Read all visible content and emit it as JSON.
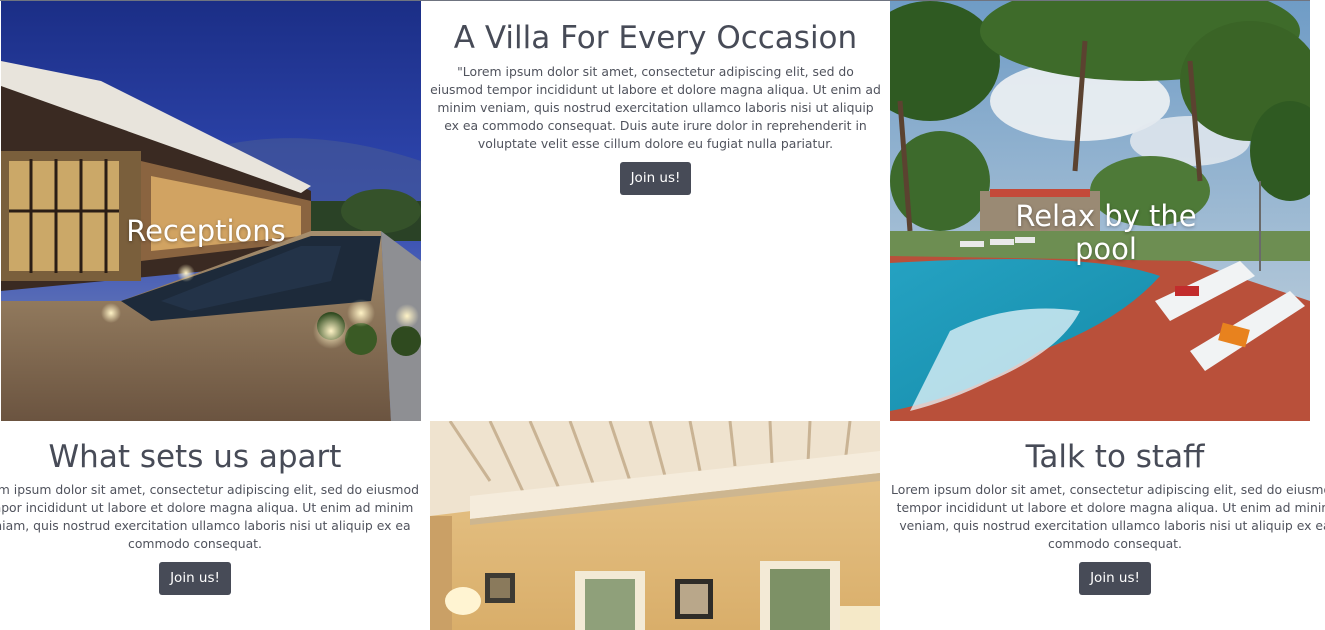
{
  "colors": {
    "text": "#474b57",
    "button_bg": "#474b57",
    "button_text": "#ffffff",
    "overlay_text": "#ffffff"
  },
  "tiles": {
    "receptions": {
      "overlay_title": "Receptions"
    },
    "villa": {
      "heading": "A Villa For Every Occasion",
      "body": "\"Lorem ipsum dolor sit amet, consectetur adipiscing elit, sed do eiusmod tempor incididunt ut labore et dolore magna aliqua. Ut enim ad minim veniam, quis nostrud exercitation ullamco laboris nisi ut aliquip ex ea commodo consequat. Duis aute irure dolor in reprehenderit in voluptate velit esse cillum dolore eu fugiat nulla pariatur.",
      "button_label": "Join us!"
    },
    "pool": {
      "overlay_title": "Relax by the pool"
    },
    "apart": {
      "heading": "What sets us apart",
      "body": "Lorem ipsum dolor sit amet, consectetur adipiscing elit, sed do eiusmod tempor incididunt ut labore et dolore magna aliqua. Ut enim ad minim veniam, quis nostrud exercitation ullamco laboris nisi ut aliquip ex ea commodo consequat.",
      "button_label": "Join us!"
    },
    "staff": {
      "heading": "Talk to staff",
      "body": "Lorem ipsum dolor sit amet, consectetur adipiscing elit, sed do eiusmod tempor incididunt ut labore et dolore magna aliqua. Ut enim ad minim veniam, quis nostrud exercitation ullamco laboris nisi ut aliquip ex ea commodo consequat.",
      "button_label": "Join us!"
    }
  }
}
